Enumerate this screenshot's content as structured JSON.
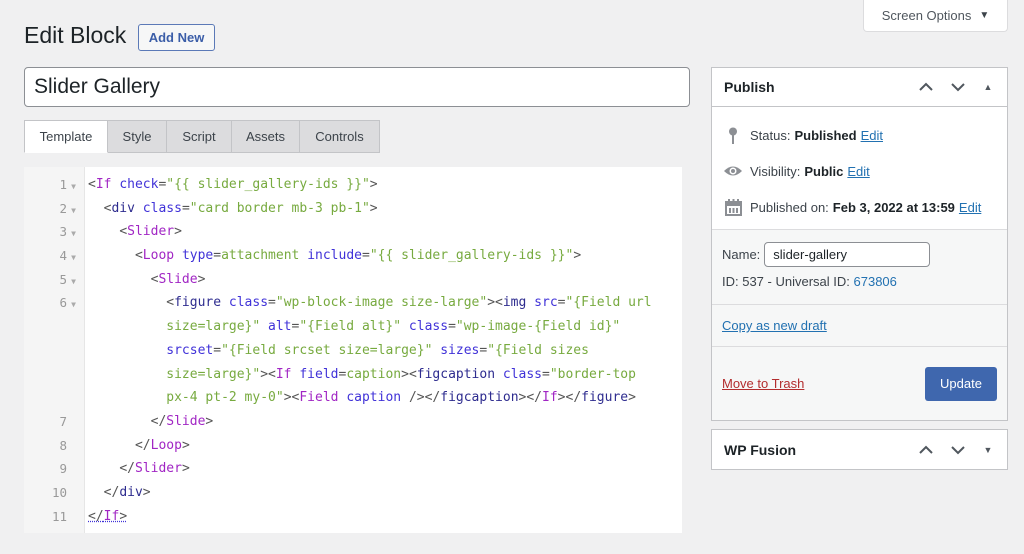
{
  "screen_options": {
    "label": "Screen Options",
    "icon": "caret-down-icon"
  },
  "header": {
    "title": "Edit Block",
    "add_new_label": "Add New"
  },
  "title_input": {
    "value": "Slider Gallery"
  },
  "tabs": [
    {
      "label": "Template",
      "active": true
    },
    {
      "label": "Style",
      "active": false
    },
    {
      "label": "Script",
      "active": false
    },
    {
      "label": "Assets",
      "active": false
    },
    {
      "label": "Controls",
      "active": false
    }
  ],
  "editor": {
    "line_numbers": [
      "1",
      "2",
      "3",
      "4",
      "5",
      "6",
      "7",
      "8",
      "9",
      "10",
      "11"
    ],
    "foldable_lines": [
      1,
      2,
      3,
      4,
      5,
      6
    ],
    "lines": [
      {
        "ln": "1",
        "text": "<If check=\"{{ slider_gallery-ids }}\">"
      },
      {
        "ln": "2",
        "text": "  <div class=\"card border mb-3 pb-1\">"
      },
      {
        "ln": "3",
        "text": "    <Slider>"
      },
      {
        "ln": "4",
        "text": "      <Loop type=attachment include=\"{{ slider_gallery-ids }}\">"
      },
      {
        "ln": "5",
        "text": "        <Slide>"
      },
      {
        "ln": "6",
        "text": "          <figure class=\"wp-block-image size-large\"><img src=\"{Field url"
      },
      {
        "ln": "",
        "text": "          size=large}\" alt=\"{Field alt}\" class=\"wp-image-{Field id}\""
      },
      {
        "ln": "",
        "text": "          srcset=\"{Field srcset size=large}\" sizes=\"{Field sizes"
      },
      {
        "ln": "",
        "text": "          size=large}\"><If field=caption><figcaption class=\"border-top"
      },
      {
        "ln": "",
        "text": "          px-4 pt-2 my-0\"><Field caption /></figcaption></If></figure>"
      },
      {
        "ln": "7",
        "text": "        </Slide>"
      },
      {
        "ln": "8",
        "text": "      </Loop>"
      },
      {
        "ln": "9",
        "text": "    </Slider>"
      },
      {
        "ln": "10",
        "text": "  </div>"
      },
      {
        "ln": "11",
        "text": "</If>"
      }
    ]
  },
  "publish": {
    "title": "Publish",
    "status_label": "Status:",
    "status_value": "Published",
    "visibility_label": "Visibility:",
    "visibility_value": "Public",
    "published_on_label": "Published on:",
    "published_on_value": "Feb 3, 2022 at 13:59",
    "edit_label": "Edit",
    "name_label": "Name:",
    "name_value": "slider-gallery",
    "id_text": "ID: 537 - Universal ID:",
    "universal_id": "673806",
    "copy_draft_label": "Copy as new draft",
    "trash_label": "Move to Trash",
    "update_label": "Update"
  },
  "wp_fusion": {
    "title": "WP Fusion"
  },
  "colors": {
    "accent": "#3f67ae",
    "link": "#2271b1",
    "trash": "#b32d2e",
    "tag": "#a126c4",
    "attr": "#4032d8",
    "string": "#77aa3f"
  }
}
